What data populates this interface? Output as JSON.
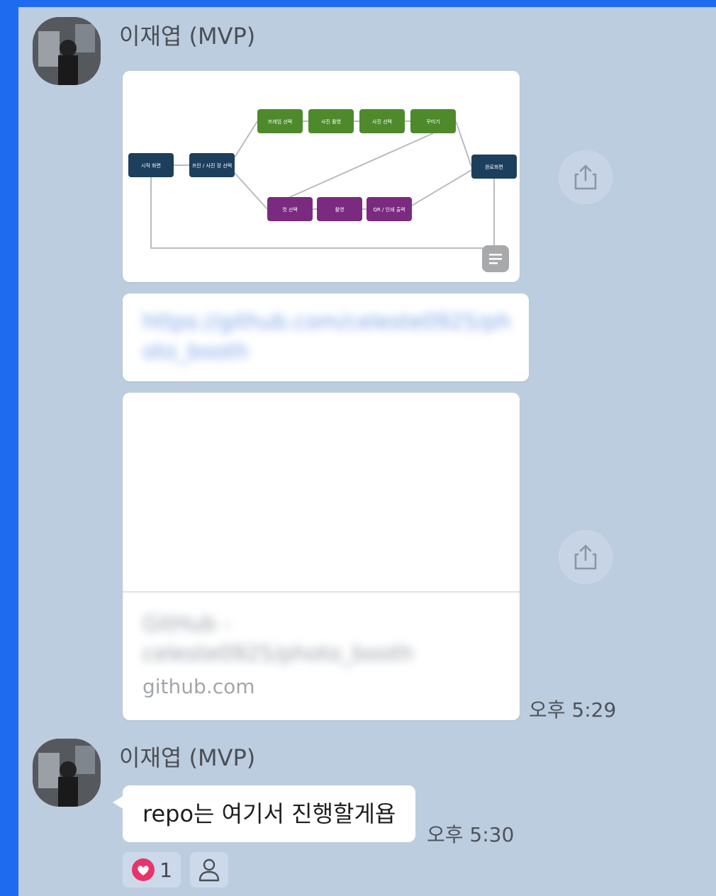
{
  "messages": [
    {
      "sender": "이재엽 (MVP)",
      "link_url": "https://github.com/celeste0925/photo_booth",
      "preview_title": "GitHub - celeste0925/photo_booth",
      "preview_domain": "github.com",
      "time": "오후 5:29"
    },
    {
      "sender": "이재엽 (MVP)",
      "text": "repo는 여기서 진행할게욥",
      "time": "오후 5:30",
      "reactions": {
        "heart_count": "1"
      }
    }
  ],
  "flowchart": {
    "nodes": [
      {
        "id": "n1",
        "label": "시작 화면",
        "color": "#1d3f5e"
      },
      {
        "id": "n2",
        "label": "프린 / 사진 장 선택",
        "color": "#1d3f5e"
      },
      {
        "id": "g1",
        "label": "프레임 선택",
        "color": "#4e8a2c"
      },
      {
        "id": "g2",
        "label": "사진 촬영",
        "color": "#4e8a2c"
      },
      {
        "id": "g3",
        "label": "사진 선택",
        "color": "#4e8a2c"
      },
      {
        "id": "g4",
        "label": "꾸미기",
        "color": "#4e8a2c"
      },
      {
        "id": "p1",
        "label": "컷 선택",
        "color": "#7a2a7f"
      },
      {
        "id": "p2",
        "label": "촬영",
        "color": "#7a2a7f"
      },
      {
        "id": "p3",
        "label": "QR / 인쇄 출력",
        "color": "#7a2a7f"
      },
      {
        "id": "n3",
        "label": "완료화면",
        "color": "#1d3f5e"
      }
    ]
  },
  "colors": {
    "chat_bg": "#bdcde0",
    "heart": "#e8336b",
    "link": "#7ea2e6"
  },
  "icons": [
    "share-icon",
    "document-icon",
    "heart-icon",
    "person-icon"
  ]
}
